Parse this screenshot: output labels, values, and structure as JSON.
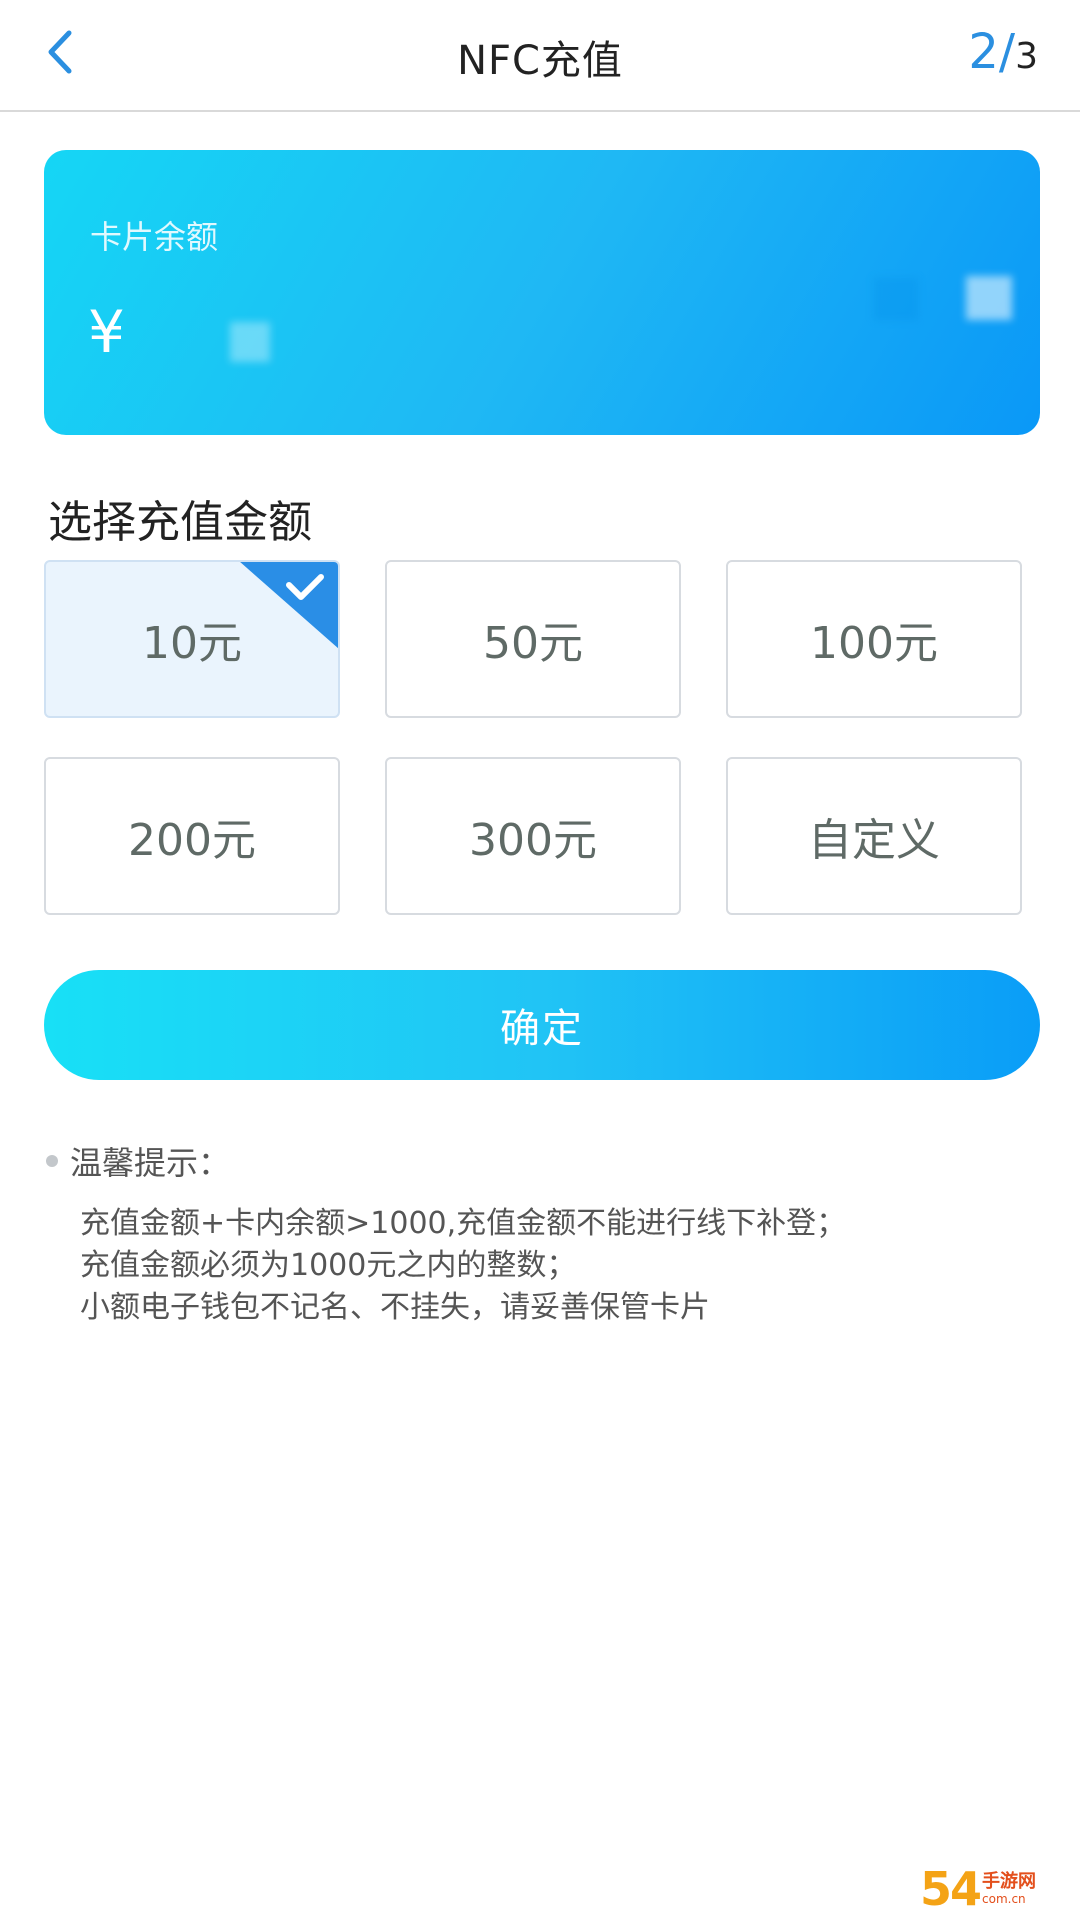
{
  "header": {
    "title": "NFC充值",
    "step_current": "2/",
    "step_total": "3"
  },
  "card": {
    "label": "卡片余额",
    "currency": "¥"
  },
  "section": {
    "title": "选择充值金额"
  },
  "options": [
    {
      "label": "10元",
      "selected": true
    },
    {
      "label": "50元",
      "selected": false
    },
    {
      "label": "100元",
      "selected": false
    },
    {
      "label": "200元",
      "selected": false
    },
    {
      "label": "300元",
      "selected": false
    },
    {
      "label": "自定义",
      "selected": false
    }
  ],
  "confirm": {
    "label": "确定"
  },
  "tips": {
    "title": "温馨提示：",
    "lines": [
      "充值金额+卡内余额>1000,充值金额不能进行线下补登；",
      "充值金额必须为1000元之内的整数；",
      "小额电子钱包不记名、不挂失，请妥善保管卡片"
    ]
  },
  "watermark": {
    "main": "54",
    "sub1": "手游网",
    "sub2": "com.cn"
  },
  "colors": {
    "accent": "#2b8fe0",
    "card_start": "#15d6f5",
    "card_end": "#0a98f7",
    "check_corner": "#2a8ee6"
  }
}
